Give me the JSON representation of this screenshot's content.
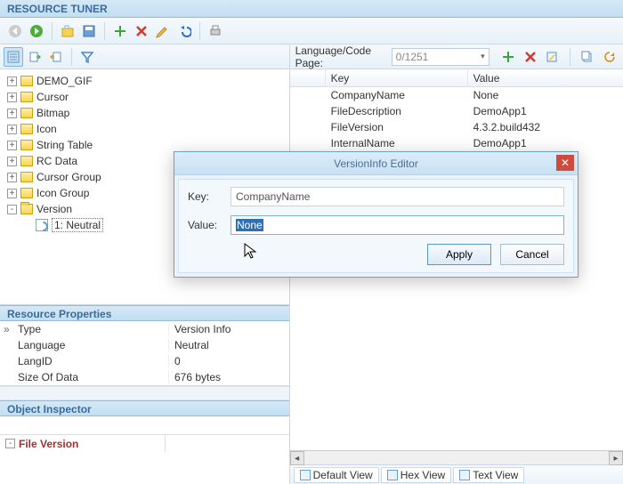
{
  "app_title": "RESOURCE TUNER",
  "tree": {
    "items": [
      {
        "label": "DEMO_GIF"
      },
      {
        "label": "Cursor"
      },
      {
        "label": "Bitmap"
      },
      {
        "label": "Icon"
      },
      {
        "label": "String Table"
      },
      {
        "label": "RC Data"
      },
      {
        "label": "Cursor Group"
      },
      {
        "label": "Icon Group"
      },
      {
        "label": "Version",
        "open": true
      },
      {
        "label": "1: Neutral",
        "child": true,
        "selected": true
      }
    ]
  },
  "props_header": "Resource Properties",
  "props": [
    {
      "k": "Type",
      "v": "Version Info"
    },
    {
      "k": "Language",
      "v": "Neutral"
    },
    {
      "k": "LangID",
      "v": "0"
    },
    {
      "k": "Size Of Data",
      "v": "676 bytes"
    }
  ],
  "obj_insp_header": "Object Inspector",
  "file_version_label": "File Version",
  "lang_label": "Language/Code Page:",
  "lang_value": "0/1251",
  "rtable": {
    "headers": {
      "key": "Key",
      "value": "Value"
    },
    "rows": [
      {
        "k": "CompanyName",
        "v": "None"
      },
      {
        "k": "FileDescription",
        "v": "DemoApp1"
      },
      {
        "k": "FileVersion",
        "v": "4.3.2.build432"
      },
      {
        "k": "InternalName",
        "v": "DemoApp1"
      }
    ]
  },
  "view_tabs": [
    "Default View",
    "Hex View",
    "Text View"
  ],
  "dialog": {
    "title": "VersionInfo Editor",
    "key_label": "Key:",
    "key_value": "CompanyName",
    "value_label": "Value:",
    "value_value": "None",
    "apply": "Apply",
    "cancel": "Cancel"
  }
}
